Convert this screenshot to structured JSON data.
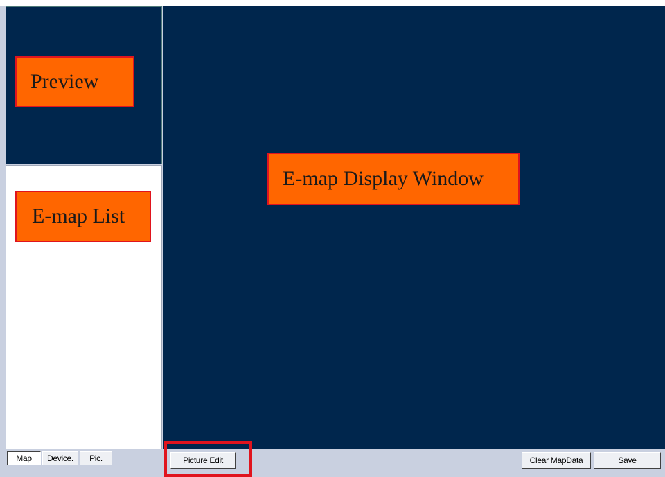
{
  "callouts": {
    "preview": "Preview",
    "emap_list": "E-map List",
    "display_window": "E-map Display Window"
  },
  "tabs": [
    {
      "label": "Map",
      "active": true
    },
    {
      "label": "Device.",
      "active": false
    },
    {
      "label": "Pic.",
      "active": false
    }
  ],
  "toolbar": {
    "picture_edit": "Picture Edit",
    "clear_mapdata": "Clear MapData",
    "save": "Save"
  },
  "colors": {
    "panel_dark": "#00264d",
    "callout_fill": "#ff6600",
    "callout_border": "#e0141e",
    "toolbar_bg": "#c9d0e0"
  }
}
